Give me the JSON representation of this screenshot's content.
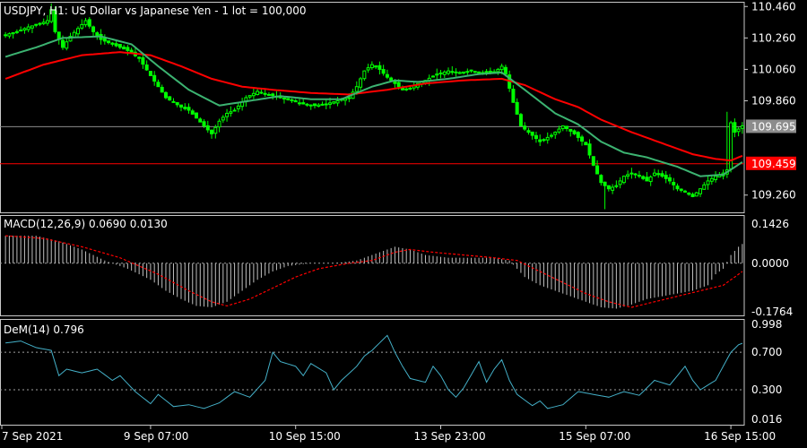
{
  "chart_data": {
    "type": "candlestick",
    "symbol": "USDJPY",
    "timeframe": "H1",
    "title": "USDJPY, H1:  US Dollar vs Japanese Yen - 1 lot = 100,000",
    "colors": {
      "background": "#000000",
      "bull_bear": "#00ff00",
      "ma_fast": "#3cb371",
      "ma_slow": "#ff0000",
      "last_price_line": "#8c8c8c",
      "red_price_line": "#ff0000",
      "last_price_label_bg": "#8c8c8c",
      "red_price_label_bg": "#ff0000",
      "macd_hist": "#c0c0c0",
      "macd_signal": "#ff0000",
      "dem_line": "#44b0c8",
      "grid_dash": "#a0a0a0",
      "border": "#c8c8c8"
    },
    "price_axis": {
      "min": 109.15,
      "max": 110.49,
      "ticks": [
        "110.460",
        "110.260",
        "110.060",
        "109.860",
        "109.260"
      ],
      "tick_values": [
        110.46,
        110.26,
        110.06,
        109.86,
        109.26
      ],
      "hidden_tick": "109.660"
    },
    "last_price": {
      "value": 109.695,
      "label": "109.695"
    },
    "red_price": {
      "value": 109.459,
      "label": "109.459"
    },
    "x_axis": {
      "labels": [
        "7 Sep 2021",
        "9 Sep 07:00",
        "10 Sep 15:00",
        "13 Sep 23:00",
        "15 Sep 07:00",
        "16 Sep 15:00"
      ],
      "label_bar_index": [
        0,
        38,
        76,
        114,
        152,
        190
      ]
    },
    "bars": {
      "count": 194,
      "close_anchors": [
        [
          0,
          110.28
        ],
        [
          3,
          110.3
        ],
        [
          6,
          110.33
        ],
        [
          9,
          110.35
        ],
        [
          11,
          110.37
        ],
        [
          12,
          110.44
        ],
        [
          13,
          110.3
        ],
        [
          15,
          110.2
        ],
        [
          17,
          110.27
        ],
        [
          19,
          110.32
        ],
        [
          21,
          110.37
        ],
        [
          23,
          110.3
        ],
        [
          25,
          110.25
        ],
        [
          27,
          110.23
        ],
        [
          30,
          110.2
        ],
        [
          32,
          110.18
        ],
        [
          35,
          110.13
        ],
        [
          38,
          110.02
        ],
        [
          40,
          109.95
        ],
        [
          42,
          109.88
        ],
        [
          44,
          109.85
        ],
        [
          46,
          109.82
        ],
        [
          48,
          109.8
        ],
        [
          50,
          109.75
        ],
        [
          52,
          109.7
        ],
        [
          54,
          109.65
        ],
        [
          56,
          109.73
        ],
        [
          58,
          109.78
        ],
        [
          60,
          109.8
        ],
        [
          63,
          109.88
        ],
        [
          66,
          109.92
        ],
        [
          69,
          109.9
        ],
        [
          72,
          109.88
        ],
        [
          75,
          109.86
        ],
        [
          78,
          109.84
        ],
        [
          81,
          109.83
        ],
        [
          84,
          109.84
        ],
        [
          87,
          109.86
        ],
        [
          90,
          109.88
        ],
        [
          92,
          109.95
        ],
        [
          94,
          110.05
        ],
        [
          96,
          110.09
        ],
        [
          98,
          110.06
        ],
        [
          100,
          110.01
        ],
        [
          102,
          109.97
        ],
        [
          104,
          109.93
        ],
        [
          106,
          109.94
        ],
        [
          108,
          109.97
        ],
        [
          110,
          109.99
        ],
        [
          113,
          110.03
        ],
        [
          116,
          110.05
        ],
        [
          119,
          110.04
        ],
        [
          122,
          110.05
        ],
        [
          125,
          110.04
        ],
        [
          128,
          110.04
        ],
        [
          130,
          110.08
        ],
        [
          131,
          110.03
        ],
        [
          133,
          109.85
        ],
        [
          135,
          109.7
        ],
        [
          137,
          109.66
        ],
        [
          140,
          109.6
        ],
        [
          143,
          109.64
        ],
        [
          146,
          109.7
        ],
        [
          149,
          109.65
        ],
        [
          152,
          109.58
        ],
        [
          154,
          109.45
        ],
        [
          156,
          109.34
        ],
        [
          158,
          109.3
        ],
        [
          160,
          109.32
        ],
        [
          162,
          109.38
        ],
        [
          164,
          109.4
        ],
        [
          166,
          109.38
        ],
        [
          168,
          109.35
        ],
        [
          170,
          109.4
        ],
        [
          172,
          109.38
        ],
        [
          174,
          109.35
        ],
        [
          176,
          109.3
        ],
        [
          178,
          109.28
        ],
        [
          180,
          109.25
        ],
        [
          182,
          109.3
        ],
        [
          184,
          109.35
        ],
        [
          186,
          109.38
        ],
        [
          188,
          109.4
        ],
        [
          189,
          109.42
        ],
        [
          190,
          109.72
        ],
        [
          191,
          109.66
        ],
        [
          192,
          109.68
        ],
        [
          193,
          109.7
        ]
      ],
      "spikes": [
        [
          12,
          110.48
        ],
        [
          189,
          109.79
        ],
        [
          157,
          109.17
        ],
        [
          55,
          109.62
        ]
      ]
    },
    "ma_fast": {
      "anchors": [
        [
          0,
          110.14
        ],
        [
          8,
          110.2
        ],
        [
          15,
          110.26
        ],
        [
          25,
          110.27
        ],
        [
          33,
          110.22
        ],
        [
          40,
          110.08
        ],
        [
          48,
          109.93
        ],
        [
          56,
          109.83
        ],
        [
          64,
          109.86
        ],
        [
          72,
          109.89
        ],
        [
          80,
          109.87
        ],
        [
          88,
          109.87
        ],
        [
          96,
          109.95
        ],
        [
          102,
          109.99
        ],
        [
          108,
          109.98
        ],
        [
          116,
          110.0
        ],
        [
          124,
          110.03
        ],
        [
          130,
          110.04
        ],
        [
          136,
          109.93
        ],
        [
          144,
          109.78
        ],
        [
          150,
          109.71
        ],
        [
          156,
          109.6
        ],
        [
          162,
          109.53
        ],
        [
          168,
          109.5
        ],
        [
          176,
          109.44
        ],
        [
          182,
          109.38
        ],
        [
          188,
          109.39
        ],
        [
          193,
          109.47
        ]
      ]
    },
    "ma_slow": {
      "anchors": [
        [
          0,
          110.0
        ],
        [
          10,
          110.09
        ],
        [
          20,
          110.15
        ],
        [
          30,
          110.17
        ],
        [
          38,
          110.15
        ],
        [
          46,
          110.08
        ],
        [
          54,
          110.0
        ],
        [
          62,
          109.95
        ],
        [
          70,
          109.93
        ],
        [
          80,
          109.91
        ],
        [
          90,
          109.9
        ],
        [
          100,
          109.93
        ],
        [
          110,
          109.97
        ],
        [
          120,
          109.99
        ],
        [
          130,
          110.0
        ],
        [
          136,
          109.96
        ],
        [
          144,
          109.87
        ],
        [
          150,
          109.82
        ],
        [
          156,
          109.74
        ],
        [
          164,
          109.66
        ],
        [
          172,
          109.59
        ],
        [
          180,
          109.52
        ],
        [
          186,
          109.49
        ],
        [
          190,
          109.48
        ],
        [
          193,
          109.51
        ]
      ]
    },
    "macd": {
      "label": "MACD(12,26,9) 0.0690 0.0130",
      "axis": {
        "max": 0.1426,
        "min": -0.1764,
        "ticks": [
          "0.1426",
          "0.0000",
          "-0.1764"
        ],
        "tick_values": [
          0.1426,
          0.0,
          -0.1764
        ]
      },
      "hist_anchors": [
        [
          0,
          0.1
        ],
        [
          8,
          0.1
        ],
        [
          14,
          0.08
        ],
        [
          20,
          0.05
        ],
        [
          26,
          0.01
        ],
        [
          32,
          -0.02
        ],
        [
          38,
          -0.06
        ],
        [
          42,
          -0.1
        ],
        [
          46,
          -0.13
        ],
        [
          50,
          -0.155
        ],
        [
          54,
          -0.16
        ],
        [
          58,
          -0.14
        ],
        [
          62,
          -0.1
        ],
        [
          66,
          -0.06
        ],
        [
          70,
          -0.03
        ],
        [
          74,
          -0.01
        ],
        [
          80,
          0.0
        ],
        [
          86,
          0.0
        ],
        [
          92,
          0.01
        ],
        [
          96,
          0.03
        ],
        [
          100,
          0.05
        ],
        [
          102,
          0.06
        ],
        [
          106,
          0.05
        ],
        [
          110,
          0.03
        ],
        [
          116,
          0.02
        ],
        [
          122,
          0.02
        ],
        [
          128,
          0.02
        ],
        [
          132,
          0.01
        ],
        [
          134,
          -0.02
        ],
        [
          136,
          -0.05
        ],
        [
          140,
          -0.08
        ],
        [
          144,
          -0.1
        ],
        [
          148,
          -0.12
        ],
        [
          152,
          -0.14
        ],
        [
          156,
          -0.16
        ],
        [
          160,
          -0.165
        ],
        [
          164,
          -0.15
        ],
        [
          168,
          -0.13
        ],
        [
          172,
          -0.12
        ],
        [
          176,
          -0.11
        ],
        [
          180,
          -0.1
        ],
        [
          184,
          -0.08
        ],
        [
          186,
          -0.04
        ],
        [
          188,
          -0.02
        ],
        [
          190,
          0.03
        ],
        [
          192,
          0.06
        ],
        [
          193,
          0.07
        ]
      ],
      "signal_anchors": [
        [
          0,
          0.1
        ],
        [
          10,
          0.09
        ],
        [
          20,
          0.06
        ],
        [
          30,
          0.02
        ],
        [
          40,
          -0.04
        ],
        [
          48,
          -0.1
        ],
        [
          54,
          -0.14
        ],
        [
          58,
          -0.155
        ],
        [
          64,
          -0.13
        ],
        [
          70,
          -0.09
        ],
        [
          76,
          -0.05
        ],
        [
          82,
          -0.02
        ],
        [
          90,
          0.0
        ],
        [
          96,
          0.01
        ],
        [
          102,
          0.04
        ],
        [
          106,
          0.05
        ],
        [
          112,
          0.04
        ],
        [
          120,
          0.03
        ],
        [
          128,
          0.02
        ],
        [
          134,
          0.01
        ],
        [
          140,
          -0.03
        ],
        [
          146,
          -0.07
        ],
        [
          152,
          -0.11
        ],
        [
          158,
          -0.14
        ],
        [
          164,
          -0.16
        ],
        [
          170,
          -0.14
        ],
        [
          176,
          -0.12
        ],
        [
          182,
          -0.1
        ],
        [
          188,
          -0.08
        ],
        [
          193,
          -0.03
        ]
      ]
    },
    "dem": {
      "label": "DeM(14) 0.796",
      "axis": {
        "max": 0.998,
        "min": -0.016,
        "ticks": [
          "0.998",
          "0.700",
          "0.300",
          "0.016"
        ],
        "tick_values": [
          0.998,
          0.7,
          0.3,
          -0.016
        ],
        "dashed_levels": [
          0.7,
          0.3
        ]
      },
      "anchors": [
        [
          0,
          0.8
        ],
        [
          4,
          0.82
        ],
        [
          8,
          0.75
        ],
        [
          12,
          0.72
        ],
        [
          14,
          0.45
        ],
        [
          16,
          0.52
        ],
        [
          20,
          0.48
        ],
        [
          24,
          0.52
        ],
        [
          28,
          0.4
        ],
        [
          30,
          0.45
        ],
        [
          34,
          0.28
        ],
        [
          38,
          0.15
        ],
        [
          40,
          0.25
        ],
        [
          44,
          0.12
        ],
        [
          48,
          0.14
        ],
        [
          52,
          0.1
        ],
        [
          56,
          0.16
        ],
        [
          60,
          0.28
        ],
        [
          64,
          0.22
        ],
        [
          68,
          0.4
        ],
        [
          70,
          0.7
        ],
        [
          72,
          0.6
        ],
        [
          76,
          0.55
        ],
        [
          78,
          0.45
        ],
        [
          80,
          0.58
        ],
        [
          84,
          0.48
        ],
        [
          86,
          0.3
        ],
        [
          88,
          0.4
        ],
        [
          92,
          0.55
        ],
        [
          94,
          0.66
        ],
        [
          96,
          0.72
        ],
        [
          100,
          0.88
        ],
        [
          102,
          0.7
        ],
        [
          104,
          0.55
        ],
        [
          106,
          0.42
        ],
        [
          110,
          0.38
        ],
        [
          112,
          0.55
        ],
        [
          114,
          0.45
        ],
        [
          116,
          0.3
        ],
        [
          118,
          0.22
        ],
        [
          120,
          0.32
        ],
        [
          124,
          0.6
        ],
        [
          126,
          0.38
        ],
        [
          128,
          0.52
        ],
        [
          130,
          0.62
        ],
        [
          132,
          0.4
        ],
        [
          134,
          0.25
        ],
        [
          138,
          0.13
        ],
        [
          140,
          0.18
        ],
        [
          142,
          0.1
        ],
        [
          146,
          0.14
        ],
        [
          150,
          0.28
        ],
        [
          154,
          0.25
        ],
        [
          158,
          0.22
        ],
        [
          162,
          0.28
        ],
        [
          166,
          0.24
        ],
        [
          170,
          0.4
        ],
        [
          174,
          0.35
        ],
        [
          176,
          0.45
        ],
        [
          178,
          0.55
        ],
        [
          180,
          0.4
        ],
        [
          182,
          0.3
        ],
        [
          184,
          0.35
        ],
        [
          186,
          0.4
        ],
        [
          188,
          0.55
        ],
        [
          190,
          0.7
        ],
        [
          192,
          0.78
        ],
        [
          193,
          0.796
        ]
      ]
    }
  }
}
